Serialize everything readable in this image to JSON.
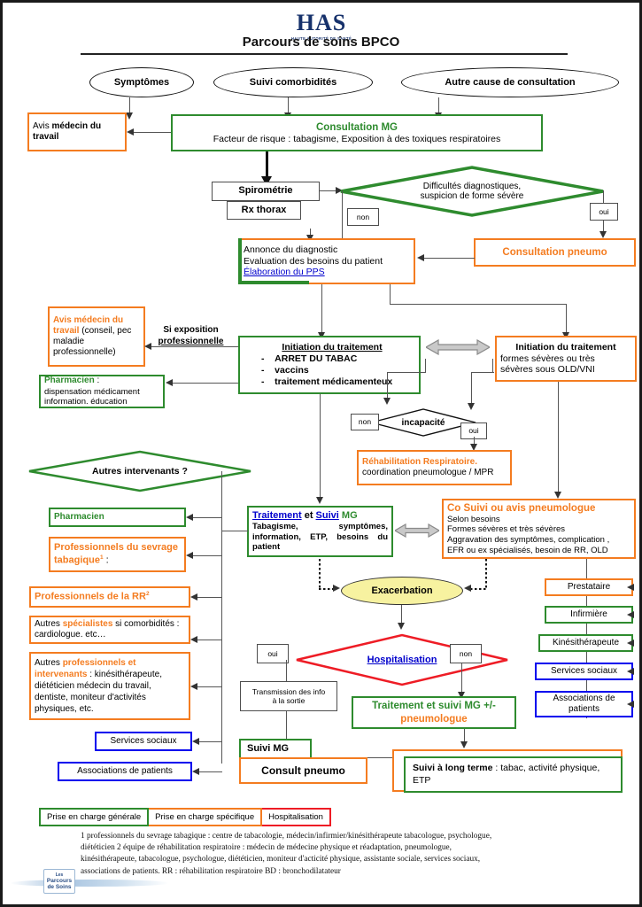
{
  "header": {
    "logo_main": "HAS",
    "logo_sub": "HAUTE AUTORITÉ DE SANTÉ",
    "title": "Parcours de soins BPCO"
  },
  "entry_nodes": [
    {
      "label": "Symptômes"
    },
    {
      "label": "Suivi comorbidités"
    },
    {
      "label": "Autre cause de consultation"
    }
  ],
  "nodes": {
    "avis_medecin_travail_top": {
      "line1": "Avis",
      "line1_bold": "médecin du travail"
    },
    "consultation_mg": {
      "title": "Consultation MG",
      "body": "Facteur de risque : tabagisme, Exposition à des toxiques respiratoires"
    },
    "spirometrie": {
      "label": "Spirométrie"
    },
    "rx_thorax": {
      "label": "Rx thorax"
    },
    "difficultes": {
      "line1": "Difficultés diagnostiques,",
      "line2": "suspicion de forme sévère"
    },
    "consultation_pneumo": {
      "label": "Consultation pneumo"
    },
    "annonce": {
      "line1": "Annonce du diagnostic",
      "line2": "Evaluation des besoins du patient",
      "link": "Élaboration du PPS"
    },
    "avis_medecin_travail_2": {
      "accent": "Avis médecin du travail",
      "rest": " (conseil, pec maladie professionnelle)"
    },
    "si_exposition": {
      "line1": "Si exposition",
      "line2": "professionnelle"
    },
    "pharmacien_disp": {
      "accent": "Pharmacien",
      "colon": " :",
      "line2": "dispensation médicament",
      "line3": "information. éducation"
    },
    "initiation_traitement": {
      "title": "Initiation du traitement",
      "items": [
        "ARRET DU TABAC",
        "vaccins",
        "traitement médicamenteux"
      ]
    },
    "initiation_severe": {
      "title": "Initiation du traitement",
      "line2": "formes sévères ou très",
      "line3": "sévères sous OLD/VNI"
    },
    "incapacite": {
      "label": "incapacité"
    },
    "rehabilitation": {
      "accent": "Réhabilitation Respiratoire.",
      "line2": "coordination pneumologue / MPR"
    },
    "autres_intervenants": {
      "label": "Autres intervenants ?"
    },
    "pharmacien": {
      "label": "Pharmacien"
    },
    "sevrage": {
      "label": "Professionnels du sevrage tabagique",
      "sup": "1",
      "suffix": " :"
    },
    "rr_pros": {
      "label": "Professionnels  de la RR",
      "sup": "2"
    },
    "autres_specialistes": {
      "p1": "Autres ",
      "accent": "spécialistes",
      "p2": "  si comorbidités : cardiologue. etc…"
    },
    "autres_pros": {
      "p1": "Autres  ",
      "accent": "professionnels et intervenants",
      "p2": " : kinésithérapeute, diététicien médecin du travail, dentiste, moniteur d'activités physiques, etc."
    },
    "services_sociaux_left": {
      "label": "Services sociaux"
    },
    "associations_left": {
      "label": "Associations de patients"
    },
    "traitement_suivi_mg": {
      "link1": "Traitement",
      "mid": " et ",
      "link2": "Suivi",
      "tail": " MG",
      "body": "Tabagisme, symptômes, information, ETP, besoins du patient"
    },
    "co_suivi": {
      "title": "Co Suivi ou avis pneumologue",
      "lines": [
        "Selon besoins",
        "Formes sévères et très sévères",
        "Aggravation des symptômes, complication ,",
        "EFR ou ex spécialisés, besoin de RR, OLD"
      ]
    },
    "prestataire": {
      "label": "Prestataire"
    },
    "infirmiere": {
      "label": "Infirmière"
    },
    "kinesitherapeute": {
      "label": "Kinésithérapeute"
    },
    "services_sociaux_right": {
      "label": "Services sociaux"
    },
    "associations_right": {
      "label": "Associations de patients"
    },
    "exacerbation": {
      "label": "Exacerbation"
    },
    "hospitalisation": {
      "label": "Hospitalisation"
    },
    "transmission": {
      "line1": "Transmission des info",
      "line2": "à la sortie"
    },
    "traitement_suivi_pneumo": {
      "line1": "Traitement et suivi MG +/-",
      "line2": "pneumologue"
    },
    "suivi_mg": {
      "label": "Suivi MG"
    },
    "consult_pneumo": {
      "label": "Consult pneumo"
    },
    "suivi_long_terme": {
      "bold": "Suivi à long terme",
      "rest": " : tabac, activité physique, ETP"
    }
  },
  "branch_labels": {
    "non_1": "non",
    "oui_1": "oui",
    "non_2": "non",
    "oui_2": "oui",
    "oui_3": "oui",
    "non_3": "non"
  },
  "legend": [
    {
      "label": "Prise en charge générale",
      "color": "#2e8b2e"
    },
    {
      "label": "Prise en charge spécifique",
      "color": "#f47c20"
    },
    {
      "label": "Hospitalisation",
      "color": "#ee1c25"
    }
  ],
  "footnotes": [
    "1 professionnels du sevrage tabagique : centre de tabacologie, médecin/infirmier/kinésithérapeute tabacologue, psychologue,",
    "diététicien 2 équipe de réhabilitation respiratoire : médecin de médecine physique et réadaptation, pneumologue,",
    "kinésithérapeute, tabacologue, psychologue, diététicien, moniteur d'acticité physique, assistante sociale, services sociaux,",
    "associations de patients.  RR : réhabilitation respiratoire  BD : bronchodilatateur"
  ],
  "footer_logo": {
    "line1": "Les",
    "line2": "Parcours",
    "line3": "de Soins"
  },
  "colors": {
    "green": "#2e8b2e",
    "orange": "#f47c20",
    "blue": "#0000ee",
    "red": "#ee1c25",
    "link": "#0000cc",
    "yellow": "#f7f2a0"
  }
}
